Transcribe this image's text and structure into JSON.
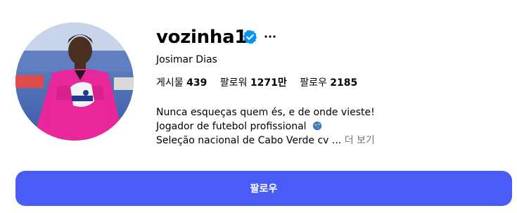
{
  "profile": {
    "username": "vozinha1",
    "full_name": "Josimar Dias",
    "verified": true
  },
  "icons": {
    "verified": "verified-badge-icon",
    "more": "more-horizontal-icon",
    "globe": "globe-icon"
  },
  "stats": {
    "posts": {
      "label": "게시물",
      "value": "439"
    },
    "followers": {
      "label": "팔로워",
      "value": "1271만"
    },
    "following": {
      "label": "팔로우",
      "value": "2185"
    }
  },
  "bio": {
    "line1": "Nunca esqueças quem és, e de onde vieste!",
    "line2": "Jogador de futebol profissional",
    "line3": "Seleção nacional de Cabo Verde cv ...",
    "more_label": "더 보기"
  },
  "actions": {
    "follow_label": "팔로우"
  },
  "colors": {
    "verified_blue": "#0095f6",
    "follow_button": "#4a5cf6",
    "muted_text": "#737373",
    "jersey_pink": "#e8279a"
  }
}
